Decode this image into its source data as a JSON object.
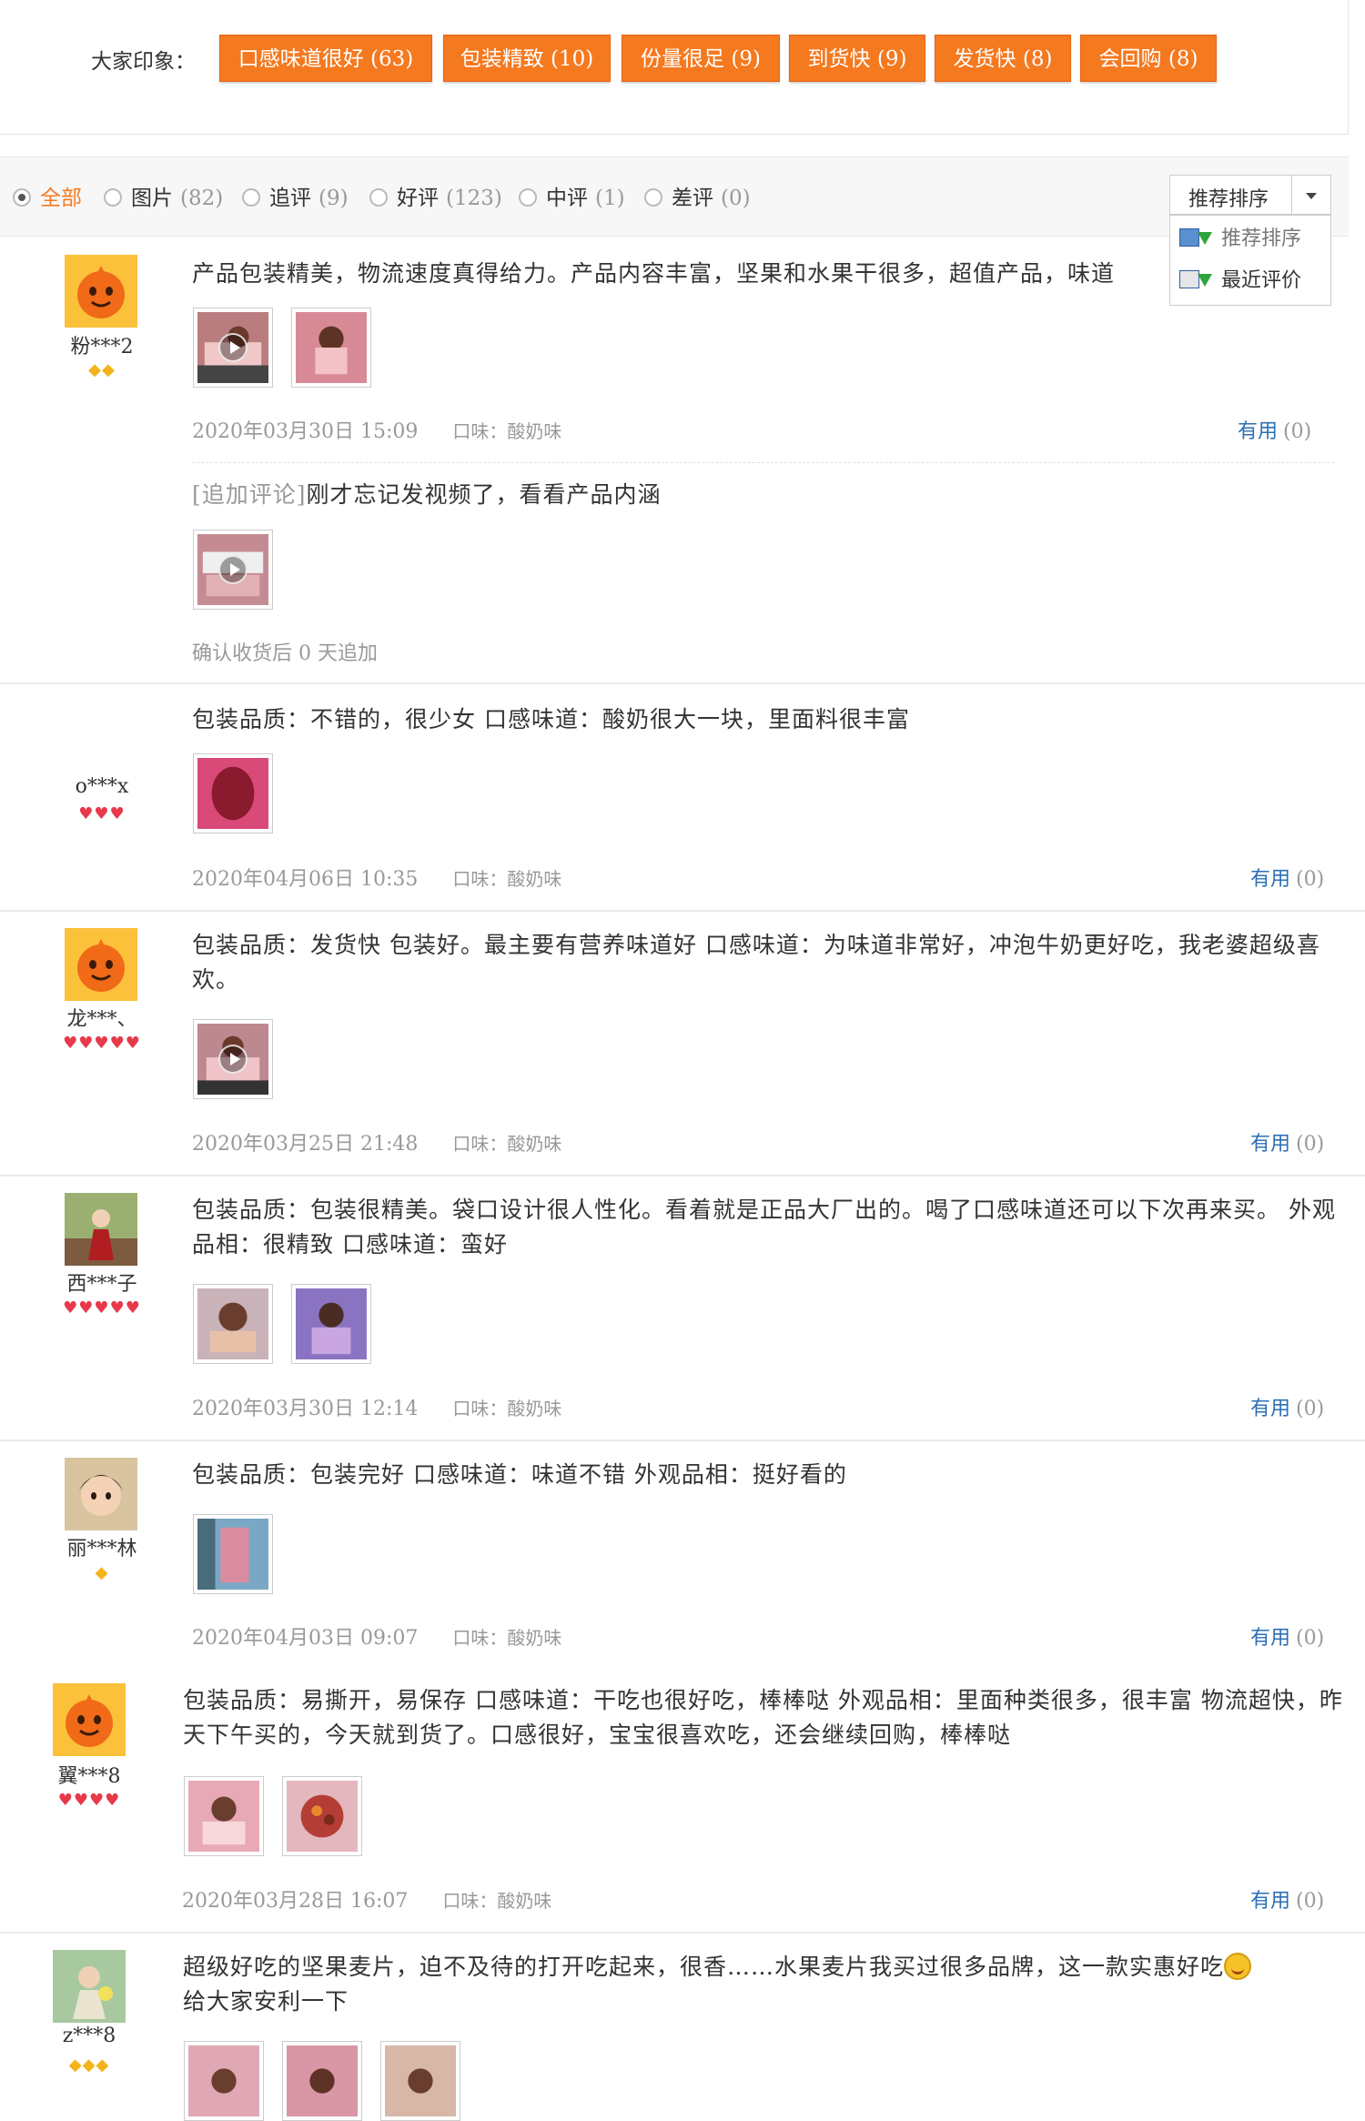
{
  "impressions": {
    "label": "大家印象：",
    "tags": [
      {
        "text": "口感味道很好 (63)"
      },
      {
        "text": "包装精致 (10)"
      },
      {
        "text": "份量很足 (9)"
      },
      {
        "text": "到货快 (9)"
      },
      {
        "text": "发货快 (8)"
      },
      {
        "text": "会回购 (8)"
      }
    ]
  },
  "filters": [
    {
      "label": "全部",
      "count": "",
      "selected": true
    },
    {
      "label": "图片",
      "count": "(82)",
      "selected": false
    },
    {
      "label": "追评",
      "count": "(9)",
      "selected": false
    },
    {
      "label": "好评",
      "count": "(123)",
      "selected": false
    },
    {
      "label": "中评",
      "count": "(1)",
      "selected": false
    },
    {
      "label": "差评",
      "count": "(0)",
      "selected": false
    }
  ],
  "sort": {
    "current": "推荐排序",
    "options": [
      "推荐排序",
      "最近评价"
    ]
  },
  "colors": {
    "accent": "#f5791f",
    "link": "#2c6fb5",
    "level_red": "#e8394a",
    "level_gold": "#f3b41b"
  },
  "reviews": [
    {
      "user": "粉***2",
      "avatar": "orange-mascot",
      "level_icons": "◆◆",
      "level_kind": "gold",
      "text": "产品包装精美，物流速度真得给力。产品内容丰富，坚果和水果干很多，超值产品，味道",
      "date": "2020年03月30日 15:09",
      "flavor": "口味：酸奶味",
      "useful_label": "有用",
      "useful_count": "(0)",
      "followup_tag": "[追加评论]",
      "followup_text": "刚才忘记发视频了，看看产品内涵",
      "followup_note": "确认收货后 0 天追加"
    },
    {
      "user": "o***x",
      "avatar": "none",
      "level_icons": "♥♥♥",
      "level_kind": "red",
      "text": "包装品质：不错的，很少女 口感味道：酸奶很大一块，里面料很丰富",
      "date": "2020年04月06日 10:35",
      "flavor": "口味：酸奶味",
      "useful_label": "有用",
      "useful_count": "(0)"
    },
    {
      "user": "龙***、",
      "avatar": "orange-mascot",
      "level_icons": "♥♥♥♥♥",
      "level_kind": "red",
      "text": "包装品质：发货快 包装好。最主要有营养味道好 口感味道：为味道非常好，冲泡牛奶更好吃，我老婆超级喜欢。",
      "date": "2020年03月25日 21:48",
      "flavor": "口味：酸奶味",
      "useful_label": "有用",
      "useful_count": "(0)"
    },
    {
      "user": "西***子",
      "avatar": "photo",
      "level_icons": "♥♥♥♥♥",
      "level_kind": "red",
      "text": "包装品质：包装很精美。袋口设计很人性化。看着就是正品大厂出的。喝了口感味道还可以下次再来买。 外观品相：很精致 口感味道：蛮好",
      "date": "2020年03月30日 12:14",
      "flavor": "口味：酸奶味",
      "useful_label": "有用",
      "useful_count": "(0)"
    },
    {
      "user": "丽***林",
      "avatar": "photo",
      "level_icons": "◆",
      "level_kind": "gold",
      "text": "包装品质：包装完好 口感味道：味道不错 外观品相：挺好看的",
      "date": "2020年04月03日 09:07",
      "flavor": "口味：酸奶味",
      "useful_label": "有用",
      "useful_count": "(0)"
    },
    {
      "user": "翼***8",
      "avatar": "orange-mascot",
      "level_icons": "♥♥♥♥",
      "level_kind": "red",
      "text": "包装品质：易撕开，易保存 口感味道：干吃也很好吃，棒棒哒 外观品相：里面种类很多，很丰富 物流超快，昨天下午买的，今天就到货了。口感很好，宝宝很喜欢吃，还会继续回购，棒棒哒",
      "date": "2020年03月28日 16:07",
      "flavor": "口味：酸奶味",
      "useful_label": "有用",
      "useful_count": "(0)"
    },
    {
      "user": "z***8",
      "avatar": "photo",
      "level_icons": "◆◆◆",
      "level_kind": "gold",
      "text": "超级好吃的坚果麦片，迫不及待的打开吃起来，很香……水果麦片我买过很多品牌，这一款实惠好吃",
      "text2": "给大家安利一下"
    }
  ]
}
